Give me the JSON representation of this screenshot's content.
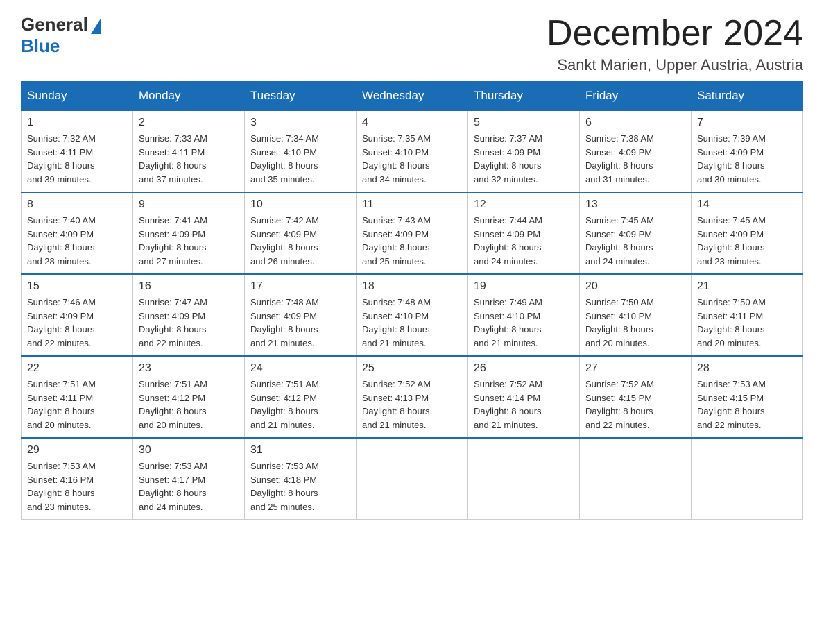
{
  "header": {
    "logo_general": "General",
    "logo_blue": "Blue",
    "title": "December 2024",
    "subtitle": "Sankt Marien, Upper Austria, Austria"
  },
  "days_of_week": [
    "Sunday",
    "Monday",
    "Tuesday",
    "Wednesday",
    "Thursday",
    "Friday",
    "Saturday"
  ],
  "weeks": [
    [
      {
        "day": "1",
        "sunrise": "7:32 AM",
        "sunset": "4:11 PM",
        "daylight": "8 hours and 39 minutes."
      },
      {
        "day": "2",
        "sunrise": "7:33 AM",
        "sunset": "4:11 PM",
        "daylight": "8 hours and 37 minutes."
      },
      {
        "day": "3",
        "sunrise": "7:34 AM",
        "sunset": "4:10 PM",
        "daylight": "8 hours and 35 minutes."
      },
      {
        "day": "4",
        "sunrise": "7:35 AM",
        "sunset": "4:10 PM",
        "daylight": "8 hours and 34 minutes."
      },
      {
        "day": "5",
        "sunrise": "7:37 AM",
        "sunset": "4:09 PM",
        "daylight": "8 hours and 32 minutes."
      },
      {
        "day": "6",
        "sunrise": "7:38 AM",
        "sunset": "4:09 PM",
        "daylight": "8 hours and 31 minutes."
      },
      {
        "day": "7",
        "sunrise": "7:39 AM",
        "sunset": "4:09 PM",
        "daylight": "8 hours and 30 minutes."
      }
    ],
    [
      {
        "day": "8",
        "sunrise": "7:40 AM",
        "sunset": "4:09 PM",
        "daylight": "8 hours and 28 minutes."
      },
      {
        "day": "9",
        "sunrise": "7:41 AM",
        "sunset": "4:09 PM",
        "daylight": "8 hours and 27 minutes."
      },
      {
        "day": "10",
        "sunrise": "7:42 AM",
        "sunset": "4:09 PM",
        "daylight": "8 hours and 26 minutes."
      },
      {
        "day": "11",
        "sunrise": "7:43 AM",
        "sunset": "4:09 PM",
        "daylight": "8 hours and 25 minutes."
      },
      {
        "day": "12",
        "sunrise": "7:44 AM",
        "sunset": "4:09 PM",
        "daylight": "8 hours and 24 minutes."
      },
      {
        "day": "13",
        "sunrise": "7:45 AM",
        "sunset": "4:09 PM",
        "daylight": "8 hours and 24 minutes."
      },
      {
        "day": "14",
        "sunrise": "7:45 AM",
        "sunset": "4:09 PM",
        "daylight": "8 hours and 23 minutes."
      }
    ],
    [
      {
        "day": "15",
        "sunrise": "7:46 AM",
        "sunset": "4:09 PM",
        "daylight": "8 hours and 22 minutes."
      },
      {
        "day": "16",
        "sunrise": "7:47 AM",
        "sunset": "4:09 PM",
        "daylight": "8 hours and 22 minutes."
      },
      {
        "day": "17",
        "sunrise": "7:48 AM",
        "sunset": "4:09 PM",
        "daylight": "8 hours and 21 minutes."
      },
      {
        "day": "18",
        "sunrise": "7:48 AM",
        "sunset": "4:10 PM",
        "daylight": "8 hours and 21 minutes."
      },
      {
        "day": "19",
        "sunrise": "7:49 AM",
        "sunset": "4:10 PM",
        "daylight": "8 hours and 21 minutes."
      },
      {
        "day": "20",
        "sunrise": "7:50 AM",
        "sunset": "4:10 PM",
        "daylight": "8 hours and 20 minutes."
      },
      {
        "day": "21",
        "sunrise": "7:50 AM",
        "sunset": "4:11 PM",
        "daylight": "8 hours and 20 minutes."
      }
    ],
    [
      {
        "day": "22",
        "sunrise": "7:51 AM",
        "sunset": "4:11 PM",
        "daylight": "8 hours and 20 minutes."
      },
      {
        "day": "23",
        "sunrise": "7:51 AM",
        "sunset": "4:12 PM",
        "daylight": "8 hours and 20 minutes."
      },
      {
        "day": "24",
        "sunrise": "7:51 AM",
        "sunset": "4:12 PM",
        "daylight": "8 hours and 21 minutes."
      },
      {
        "day": "25",
        "sunrise": "7:52 AM",
        "sunset": "4:13 PM",
        "daylight": "8 hours and 21 minutes."
      },
      {
        "day": "26",
        "sunrise": "7:52 AM",
        "sunset": "4:14 PM",
        "daylight": "8 hours and 21 minutes."
      },
      {
        "day": "27",
        "sunrise": "7:52 AM",
        "sunset": "4:15 PM",
        "daylight": "8 hours and 22 minutes."
      },
      {
        "day": "28",
        "sunrise": "7:53 AM",
        "sunset": "4:15 PM",
        "daylight": "8 hours and 22 minutes."
      }
    ],
    [
      {
        "day": "29",
        "sunrise": "7:53 AM",
        "sunset": "4:16 PM",
        "daylight": "8 hours and 23 minutes."
      },
      {
        "day": "30",
        "sunrise": "7:53 AM",
        "sunset": "4:17 PM",
        "daylight": "8 hours and 24 minutes."
      },
      {
        "day": "31",
        "sunrise": "7:53 AM",
        "sunset": "4:18 PM",
        "daylight": "8 hours and 25 minutes."
      },
      null,
      null,
      null,
      null
    ]
  ],
  "labels": {
    "sunrise": "Sunrise:",
    "sunset": "Sunset:",
    "daylight": "Daylight:"
  }
}
